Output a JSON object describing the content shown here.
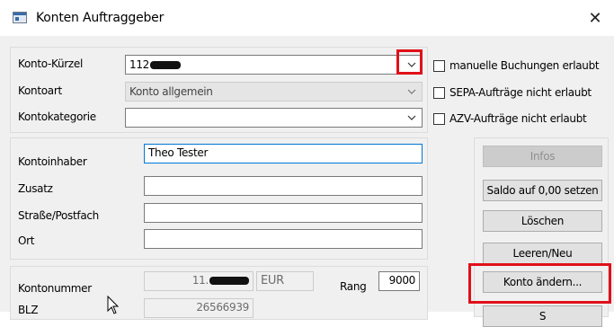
{
  "window": {
    "title": "Konten Auftraggeber",
    "close_glyph": "✕",
    "icon": "window-icon"
  },
  "account": {
    "kuerzel_label": "Konto-Kürzel",
    "kuerzel_value": "112",
    "kontoart_label": "Kontoart",
    "kontoart_value": "Konto allgemein",
    "kategorie_label": "Kontokategorie",
    "kategorie_value": ""
  },
  "options": {
    "manuelle_buchungen": "manuelle Buchungen erlaubt",
    "sepa_nicht_erlaubt": "SEPA-Aufträge nicht erlaubt",
    "azv_nicht_erlaubt": "AZV-Aufträge nicht erlaubt"
  },
  "holder": {
    "kontoinhaber_label": "Kontoinhaber",
    "kontoinhaber_value": "Theo Tester",
    "zusatz_label": "Zusatz",
    "zusatz_value": "",
    "strasse_label": "Straße/Postfach",
    "strasse_value": "",
    "ort_label": "Ort",
    "ort_value": ""
  },
  "bank": {
    "kontonummer_label": "Kontonummer",
    "kontonummer_value": "11.",
    "currency": "EUR",
    "rang_label": "Rang",
    "rang_value": "9000",
    "blz_label": "BLZ",
    "blz_value": "26566939"
  },
  "buttons": {
    "infos": "Infos",
    "saldo": "Saldo auf 0,00 setzen",
    "loeschen": "Löschen",
    "leeren": "Leeren/Neu",
    "konto_aendern": "Konto ändern...",
    "speichern_partial": "S"
  },
  "colors": {
    "highlight": "#e0101a",
    "focus_border": "#0078d7"
  }
}
